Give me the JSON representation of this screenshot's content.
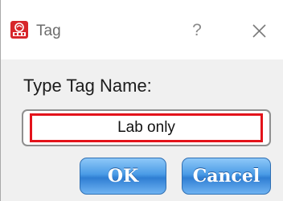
{
  "window": {
    "title": "Tag",
    "app_icon": "tdm-logo-icon",
    "help_label": "?",
    "close_icon": "close-icon"
  },
  "dialog": {
    "prompt": "Type Tag Name:",
    "tag_input_value": "Lab only",
    "ok_label": "OK",
    "cancel_label": "Cancel"
  },
  "colors": {
    "accent_red": "#e3131b",
    "button_blue": "#4a9be6",
    "dialog_bg": "#f0f0f0"
  }
}
